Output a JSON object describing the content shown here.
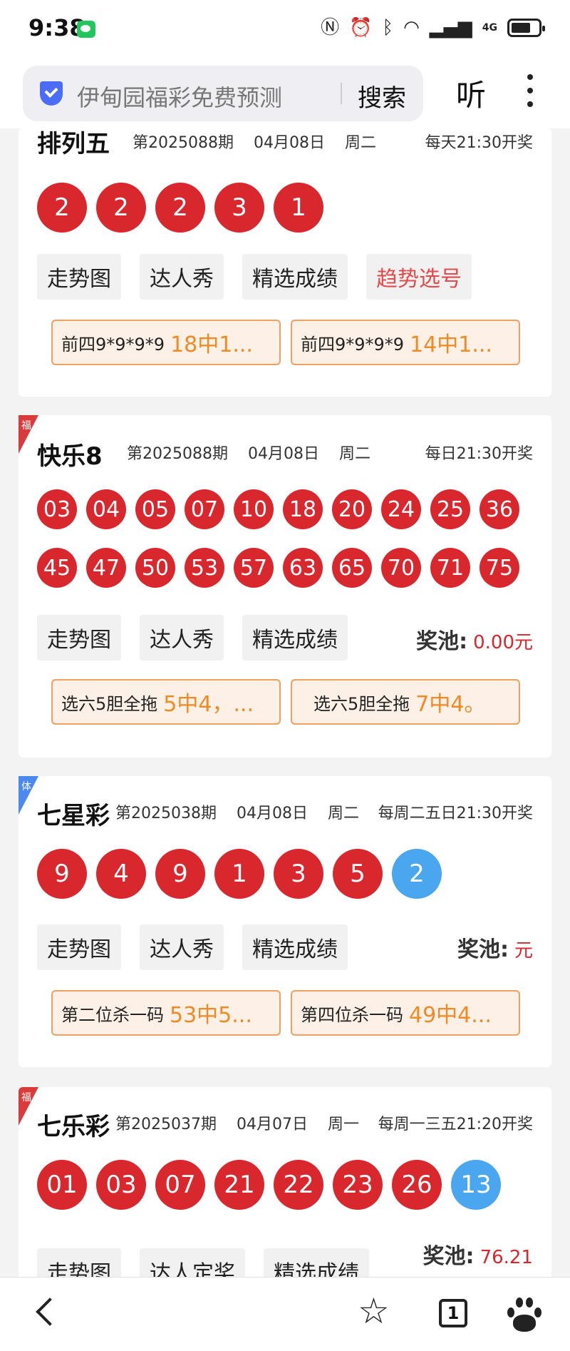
{
  "status": {
    "time": "9:38",
    "net": "4G"
  },
  "search": {
    "query": "伊甸园福彩免费预测",
    "button": "搜索",
    "listen": "听"
  },
  "cards": [
    {
      "title": "排列五",
      "issue": "第2025088期",
      "date": "04月08日",
      "weekday": "周二",
      "schedule": "每天21:30开奖",
      "balls": [
        "2",
        "2",
        "2",
        "3",
        "1"
      ],
      "buttons": [
        "走势图",
        "达人秀",
        "精选成绩",
        "趋势选号"
      ],
      "tips": [
        {
          "label": "前四9*9*9*9",
          "value": "18中1..."
        },
        {
          "label": "前四9*9*9*9",
          "value": "14中1..."
        }
      ]
    },
    {
      "badge": "福",
      "title": "快乐8",
      "issue": "第2025088期",
      "date": "04月08日",
      "weekday": "周二",
      "schedule": "每日21:30开奖",
      "balls_row1": [
        "03",
        "04",
        "05",
        "07",
        "10",
        "18",
        "20",
        "24",
        "25",
        "36"
      ],
      "balls_row2": [
        "45",
        "47",
        "50",
        "53",
        "57",
        "63",
        "65",
        "70",
        "71",
        "75"
      ],
      "buttons": [
        "走势图",
        "达人秀",
        "精选成绩"
      ],
      "pool_label": "奖池:",
      "pool_value": "0.00元",
      "tips": [
        {
          "label": "选六5胆全拖",
          "value": "5中4，..."
        },
        {
          "label": "选六5胆全拖",
          "value": "7中4。"
        }
      ]
    },
    {
      "badge": "体",
      "title": "七星彩",
      "issue": "第2025038期",
      "date": "04月08日",
      "weekday": "周二",
      "schedule": "每周二五日21:30开奖",
      "balls": [
        "9",
        "4",
        "9",
        "1",
        "3",
        "5"
      ],
      "blue_ball": "2",
      "buttons": [
        "走势图",
        "达人秀",
        "精选成绩"
      ],
      "pool_label": "奖池:",
      "pool_value": "元",
      "tips": [
        {
          "label": "第二位杀一码",
          "value": "53中5..."
        },
        {
          "label": "第四位杀一码",
          "value": "49中4..."
        }
      ]
    },
    {
      "badge": "福",
      "title": "七乐彩",
      "issue": "第2025037期",
      "date": "04月07日",
      "weekday": "周一",
      "schedule": "每周一三五21:20开奖",
      "balls": [
        "01",
        "03",
        "07",
        "21",
        "22",
        "23",
        "26"
      ],
      "blue_ball": "13",
      "buttons": [
        "走势图",
        "达人定奖",
        "精选成绩"
      ],
      "pool_label": "奖池:",
      "pool_value": "76.21"
    }
  ],
  "nav": {
    "tab_count": "1"
  },
  "colors": {
    "red_ball": "#d9272e",
    "blue_ball": "#4aa6ee",
    "orange": "#f08a24"
  }
}
